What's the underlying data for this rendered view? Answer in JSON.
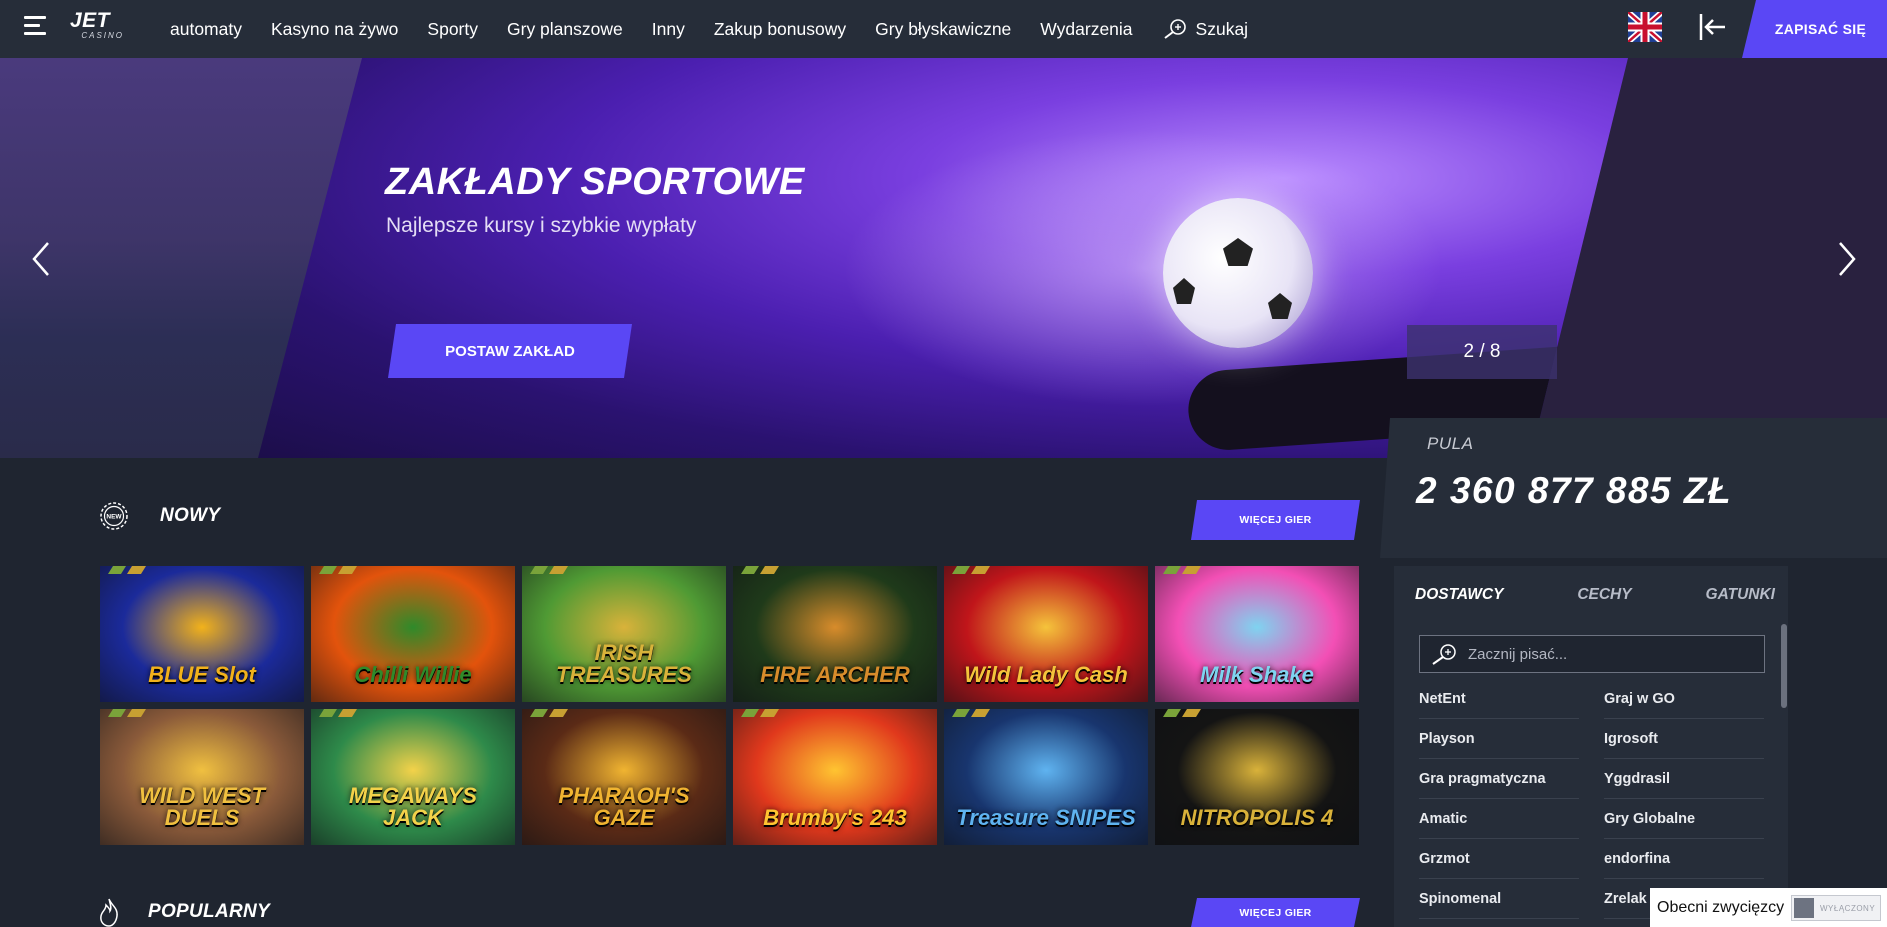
{
  "header": {
    "logo_main": "JET",
    "logo_sub": "CASINO",
    "nav": [
      "automaty",
      "Kasyno na żywo",
      "Sporty",
      "Gry planszowe",
      "Inny",
      "Zakup bonusowy",
      "Gry błyskawiczne",
      "Wydarzenia"
    ],
    "search_label": "Szukaj",
    "signup_label": "ZAPISAĆ SIĘ"
  },
  "hero": {
    "title": "ZAKŁADY SPORTOWE",
    "subtitle": "Najlepsze kursy i szybkie wypłaty",
    "button": "POSTAW ZAKŁAD",
    "counter": "2 / 8"
  },
  "jackpot": {
    "label": "PULA",
    "value": "2 360 877 885 ZŁ"
  },
  "sections": {
    "new_title": "NOWY",
    "new_more": "WIĘCEJ GIER",
    "popular_title": "POPULARNY",
    "popular_more": "WIĘCEJ GIER"
  },
  "games": [
    {
      "name": "BLUE Slot",
      "bg": "#1b2a9a",
      "accent": "#f2b21b"
    },
    {
      "name": "Chilli Willie",
      "bg": "#e3530c",
      "accent": "#2f8a2a"
    },
    {
      "name": "IRISH TREASURES",
      "bg": "#4f9a34",
      "accent": "#d9b23a"
    },
    {
      "name": "FIRE ARCHER",
      "bg": "#1f3a1a",
      "accent": "#d88c2b"
    },
    {
      "name": "Wild Lady Cash",
      "bg": "#c0151a",
      "accent": "#f5c33b"
    },
    {
      "name": "Milk Shake",
      "bg": "#f34fb5",
      "accent": "#7fd3f0"
    },
    {
      "name": "WILD WEST DUELS",
      "bg": "#8a5a3a",
      "accent": "#f0c040"
    },
    {
      "name": "MEGAWAYS JACK",
      "bg": "#2e8a4a",
      "accent": "#f3d24a"
    },
    {
      "name": "PHARAOH'S GAZE",
      "bg": "#5a2a16",
      "accent": "#f0b431"
    },
    {
      "name": "Brumby's 243",
      "bg": "#e0381c",
      "accent": "#ffc431"
    },
    {
      "name": "Treasure SNIPES",
      "bg": "#18356e",
      "accent": "#5fb3f0"
    },
    {
      "name": "NITROPOLIS 4",
      "bg": "#141414",
      "accent": "#d9b23a"
    }
  ],
  "panel": {
    "tabs": [
      "DOSTAWCY",
      "CECHY",
      "GATUNKI"
    ],
    "search_placeholder": "Zacznij pisać...",
    "providers": [
      "NetEnt",
      "Graj w GO",
      "Playson",
      "Igrosoft",
      "Gra pragmatyczna",
      "Yggdrasil",
      "Amatic",
      "Gry Globalne",
      "Grzmot",
      "endorfina",
      "Spinomenal",
      "Zrelak"
    ]
  },
  "winners": {
    "label": "Obecni zwycięzcy",
    "toggle": "WYŁĄCZONY"
  }
}
